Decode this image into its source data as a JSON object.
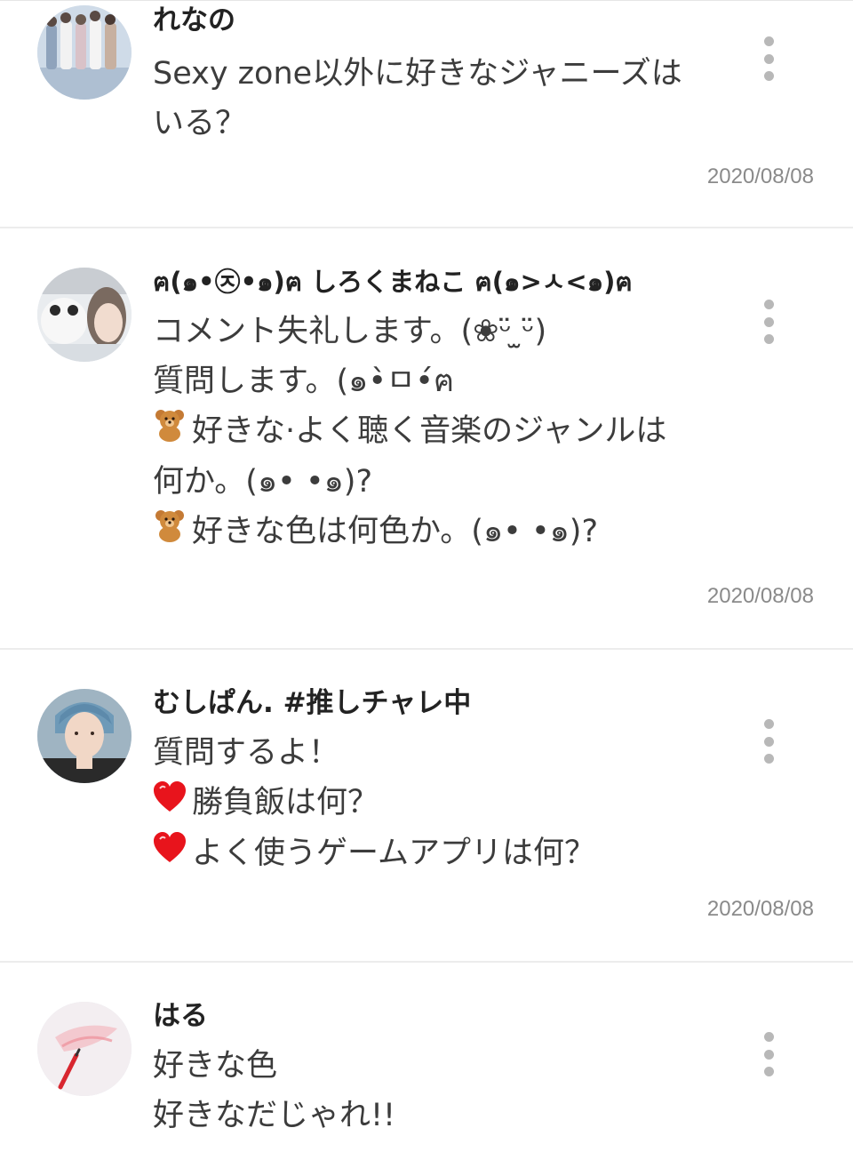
{
  "posts": [
    {
      "username": "れなの",
      "lines": [
        {
          "icon": "",
          "text": "Sexy zone以外に好きなジャニーズは"
        },
        {
          "icon": "",
          "text": "いる？"
        }
      ],
      "date": "2020/08/08",
      "avatar_icon": "group-photo-avatar"
    },
    {
      "username": "ฅ(๑•㉨•๑)ฅ しろくまねこ ฅ(๑>ㅅ<๑)ฅ",
      "lines": [
        {
          "icon": "",
          "text": "コメント失礼します。(❀ᵕ̈ ̫ᵕ̈)"
        },
        {
          "icon": "",
          "text": "質問します。(๑•̀ㅁ•́ฅ"
        },
        {
          "icon": "teddy-bear-icon",
          "text": "好きな·よく聴く音楽のジャンルは"
        },
        {
          "icon": "",
          "text": "何か。(๑• •๑)?"
        },
        {
          "icon": "teddy-bear-icon",
          "text": "好きな色は何色か。(๑• •๑)?"
        }
      ],
      "date": "2020/08/08",
      "avatar_icon": "plush-photo-avatar"
    },
    {
      "username": "むしぱん. #推しチャレ中",
      "lines": [
        {
          "icon": "",
          "text": "質問するよ！"
        },
        {
          "icon": "heart-icon",
          "text": "勝負飯は何？"
        },
        {
          "icon": "heart-icon",
          "text": "よく使うゲームアプリは何？"
        }
      ],
      "date": "2020/08/08",
      "avatar_icon": "person-photo-avatar"
    },
    {
      "username": "はる",
      "lines": [
        {
          "icon": "",
          "text": "好きな色"
        },
        {
          "icon": "",
          "text": "好きなだじゃれ!!"
        }
      ],
      "date": "",
      "avatar_icon": "pencil-photo-avatar"
    }
  ],
  "colors": {
    "heart": "#e8141c",
    "bear": "#d08a3c",
    "date": "#8a8a8a",
    "divider": "#ececec"
  }
}
